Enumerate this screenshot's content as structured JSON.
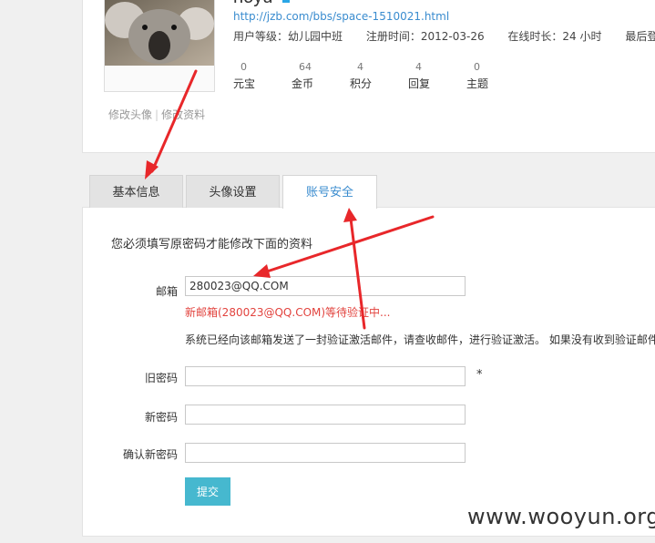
{
  "profile": {
    "username": "hoyu",
    "space_url": "http://jzb.com/bbs/space-1510021.html",
    "user_group": "用户等级：幼儿园中班",
    "register_time": "注册时间：2012-03-26",
    "online_time": "在线时长：24 小时",
    "last_login": "最后登录",
    "stats": [
      {
        "value": "0",
        "label": "元宝"
      },
      {
        "value": "64",
        "label": "金币"
      },
      {
        "value": "4",
        "label": "积分"
      },
      {
        "value": "4",
        "label": "回复"
      },
      {
        "value": "0",
        "label": "主题"
      }
    ],
    "avatar_links": {
      "change_avatar": "修改头像",
      "separator": "|",
      "edit_profile": "修改资料"
    }
  },
  "tabs": [
    {
      "label": "基本信息"
    },
    {
      "label": "头像设置"
    },
    {
      "label": "账号安全"
    }
  ],
  "form": {
    "notice": "您必须填写原密码才能修改下面的资料",
    "email": {
      "label": "邮箱",
      "value": "280023@QQ.COM"
    },
    "pending_notice": "新邮箱(280023@QQ.COM)等待验证中...",
    "system_message": "系统已经向该邮箱发送了一封验证激活邮件，请查收邮件，进行验证激活。 如果没有收到验证邮件",
    "old_password": {
      "label": "旧密码",
      "value": "",
      "required_mark": "*"
    },
    "new_password": {
      "label": "新密码",
      "value": ""
    },
    "confirm_password": {
      "label": "确认新密码",
      "value": ""
    },
    "submit_label": "提交"
  },
  "watermark": "www.wooyun.org",
  "colors": {
    "accent": "#3a8ccf",
    "warning": "#e2433e",
    "submit": "#46b8cf",
    "annotation_arrow": "#e8272a"
  }
}
